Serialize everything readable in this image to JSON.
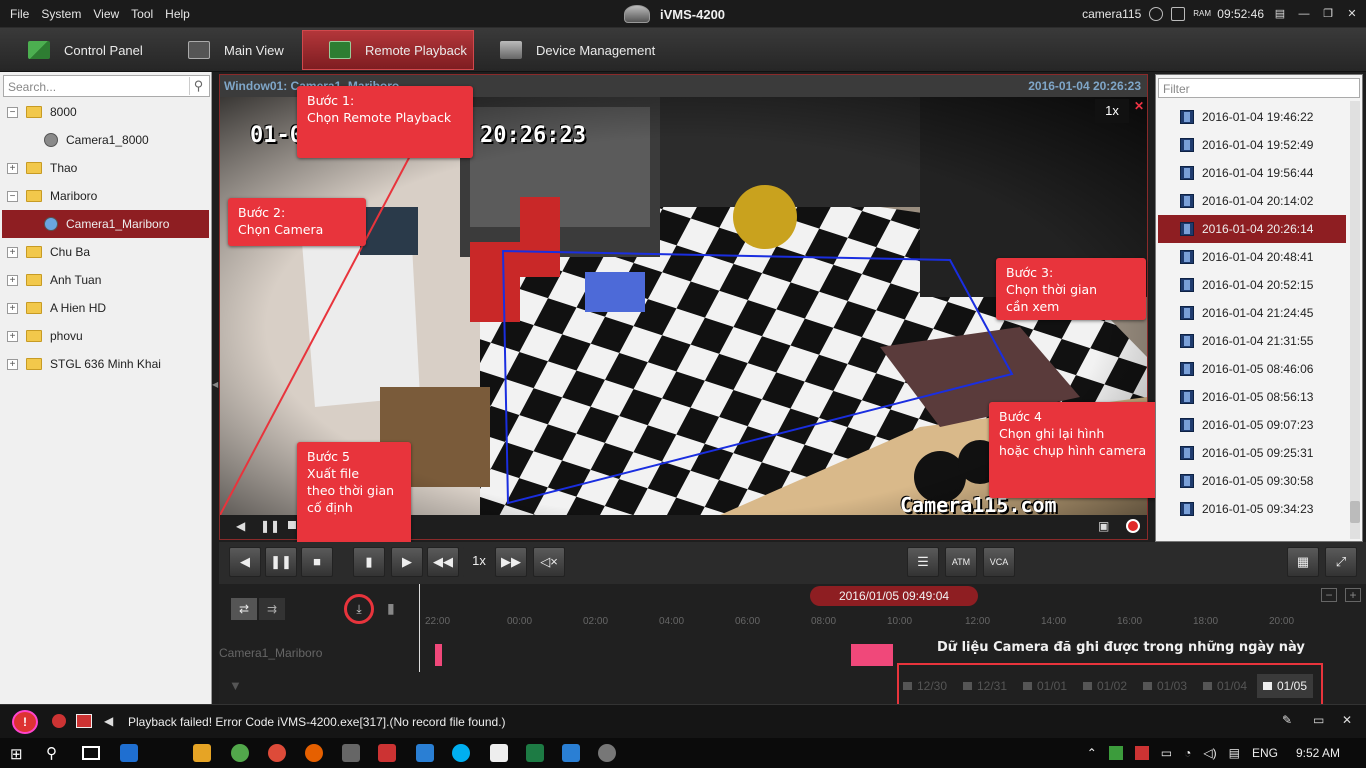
{
  "menu": [
    "File",
    "System",
    "View",
    "Tool",
    "Help"
  ],
  "app_title": "iVMS-4200",
  "title_right": {
    "user": "camera115",
    "time": "09:52:46",
    "ram_label": "RAM"
  },
  "tabs": [
    {
      "label": "Control Panel",
      "active": false
    },
    {
      "label": "Main View",
      "active": false
    },
    {
      "label": "Remote Playback",
      "active": true
    },
    {
      "label": "Device Management",
      "active": false
    }
  ],
  "search": {
    "placeholder": "Search..."
  },
  "tree": [
    {
      "label": "8000",
      "type": "folder",
      "expanded": true
    },
    {
      "label": "Camera1_8000",
      "type": "camera"
    },
    {
      "label": "Thao",
      "type": "folder",
      "expanded": false
    },
    {
      "label": "Mariboro",
      "type": "folder",
      "expanded": true
    },
    {
      "label": "Camera1_Mariboro",
      "type": "camera",
      "selected": true
    },
    {
      "label": "Chu Ba",
      "type": "folder",
      "expanded": false
    },
    {
      "label": "Anh Tuan",
      "type": "folder",
      "expanded": false
    },
    {
      "label": "A Hien HD",
      "type": "folder",
      "expanded": false
    },
    {
      "label": "phovu",
      "type": "folder",
      "expanded": false
    },
    {
      "label": "STGL 636 Minh Khai",
      "type": "folder",
      "expanded": false
    }
  ],
  "video": {
    "window_label": "Window01:  Camera1_Mariboro",
    "timestamp": "2016-01-04 20:26:23",
    "speed_badge": "1x",
    "osd_date": "01-0",
    "osd_time": "20:26:23",
    "watermark": "Camera115.com"
  },
  "callouts": {
    "step1": "Bước 1:\nChọn Remote Playback",
    "step2": "Bước 2:\nChọn Camera",
    "step3": "Bước 3:\nChọn thời gian\ncần xem",
    "step4": "Bước 4\nChọn ghi lại hình\nhoặc chụp hình camera",
    "step5": "Bước 5\nXuất file\ntheo thời gian\ncố định"
  },
  "filter": {
    "placeholder": "Filter"
  },
  "records": [
    {
      "label": "2016-01-04 19:46:22"
    },
    {
      "label": "2016-01-04 19:52:49"
    },
    {
      "label": "2016-01-04 19:56:44"
    },
    {
      "label": "2016-01-04 20:14:02"
    },
    {
      "label": "2016-01-04 20:26:14",
      "selected": true
    },
    {
      "label": "2016-01-04 20:48:41"
    },
    {
      "label": "2016-01-04 20:52:15"
    },
    {
      "label": "2016-01-04 21:24:45"
    },
    {
      "label": "2016-01-04 21:31:55"
    },
    {
      "label": "2016-01-05 08:46:06"
    },
    {
      "label": "2016-01-05 08:56:13"
    },
    {
      "label": "2016-01-05 09:07:23"
    },
    {
      "label": "2016-01-05 09:25:31"
    },
    {
      "label": "2016-01-05 09:30:58"
    },
    {
      "label": "2016-01-05 09:34:23"
    }
  ],
  "controls": {
    "speed": "1x"
  },
  "timeline": {
    "current_time": "2016/01/05 09:49:04",
    "camera_label": "Camera1_Mariboro",
    "hours": [
      "22:00",
      "00:00",
      "02:00",
      "04:00",
      "06:00",
      "08:00",
      "10:00",
      "12:00",
      "14:00",
      "16:00",
      "18:00",
      "20:00"
    ],
    "caption": "Dữ liệu Camera đã ghi được trong những ngày này",
    "dates": [
      {
        "label": "12/30"
      },
      {
        "label": "12/31"
      },
      {
        "label": "01/01"
      },
      {
        "label": "01/02"
      },
      {
        "label": "01/03"
      },
      {
        "label": "01/04"
      },
      {
        "label": "01/05",
        "active": true
      }
    ]
  },
  "status": {
    "message": "Playback failed! Error Code iVMS-4200.exe[317].(No record file found.)"
  },
  "taskbar": {
    "language": "ENG",
    "time": "9:52 AM"
  },
  "colors": {
    "accent": "#8e1e22",
    "callout": "#e8343c",
    "link_blue": "#7fa6c8"
  }
}
